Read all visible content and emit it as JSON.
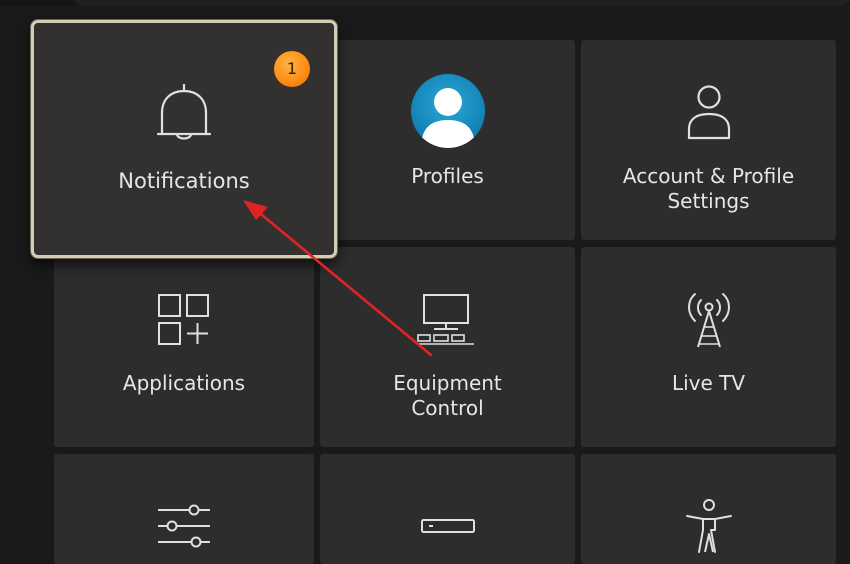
{
  "tiles": {
    "notifications": {
      "label": "Notifications",
      "icon": "bell-icon",
      "badge": "1"
    },
    "profiles": {
      "label": "Profiles",
      "icon": "profile-avatar-icon"
    },
    "account": {
      "label": "Account & Profile\nSettings",
      "icon": "person-icon"
    },
    "applications": {
      "label": "Applications",
      "icon": "apps-grid-icon"
    },
    "equipment": {
      "label": "Equipment\nControl",
      "icon": "tv-equipment-icon"
    },
    "livetv": {
      "label": "Live TV",
      "icon": "broadcast-tower-icon"
    },
    "preferences": {
      "icon": "sliders-icon"
    },
    "device": {
      "icon": "device-box-icon"
    },
    "accessibility": {
      "icon": "accessibility-figure-icon"
    }
  },
  "colors": {
    "background": "#1a1a1a",
    "tile": "#2d2d2d",
    "focus_border": "#d4cdb4",
    "badge": "#ff8f17",
    "avatar": "#1a8fc4",
    "arrow": "#e02424"
  }
}
